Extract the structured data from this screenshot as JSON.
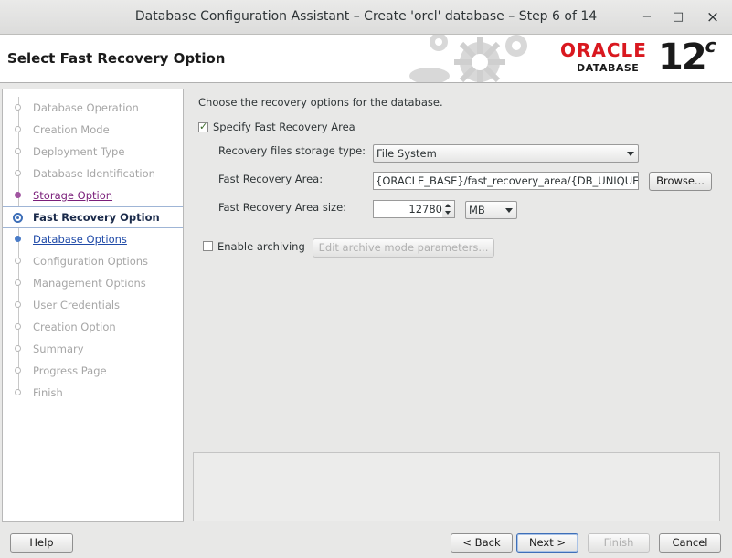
{
  "window": {
    "title": "Database Configuration Assistant – Create 'orcl' database – Step 6 of 14",
    "minimize": "−",
    "maximize": "□",
    "close": "×"
  },
  "header": {
    "page_title": "Select Fast Recovery Option",
    "brand": "ORACLE",
    "brand_sub": "DATABASE",
    "version": "12",
    "version_sup": "c"
  },
  "steps": [
    {
      "label": "Database Operation",
      "state": "disabled"
    },
    {
      "label": "Creation Mode",
      "state": "disabled"
    },
    {
      "label": "Deployment Type",
      "state": "disabled"
    },
    {
      "label": "Database Identification",
      "state": "disabled"
    },
    {
      "label": "Storage Option",
      "state": "visited"
    },
    {
      "label": "Fast Recovery Option",
      "state": "current"
    },
    {
      "label": "Database Options",
      "state": "next"
    },
    {
      "label": "Configuration Options",
      "state": "disabled"
    },
    {
      "label": "Management Options",
      "state": "disabled"
    },
    {
      "label": "User Credentials",
      "state": "disabled"
    },
    {
      "label": "Creation Option",
      "state": "disabled"
    },
    {
      "label": "Summary",
      "state": "disabled"
    },
    {
      "label": "Progress Page",
      "state": "disabled"
    },
    {
      "label": "Finish",
      "state": "disabled"
    }
  ],
  "form": {
    "intro": "Choose the recovery options for the database.",
    "specify_fra": {
      "label": "Specify Fast Recovery Area",
      "checked": true
    },
    "storage_type": {
      "label": "Recovery files storage type:",
      "value": "File System"
    },
    "fra_location": {
      "label": "Fast Recovery Area:",
      "value": "{ORACLE_BASE}/fast_recovery_area/{DB_UNIQUE_"
    },
    "browse_label": "Browse...",
    "fra_size": {
      "label": "Fast Recovery Area size:",
      "value": "12780",
      "unit": "MB"
    },
    "archiving": {
      "label": "Enable archiving",
      "checked": false
    },
    "edit_archive_label": "Edit archive mode parameters..."
  },
  "footer": {
    "help": "Help",
    "back": "< Back",
    "next": "Next >",
    "finish": "Finish",
    "cancel": "Cancel"
  }
}
